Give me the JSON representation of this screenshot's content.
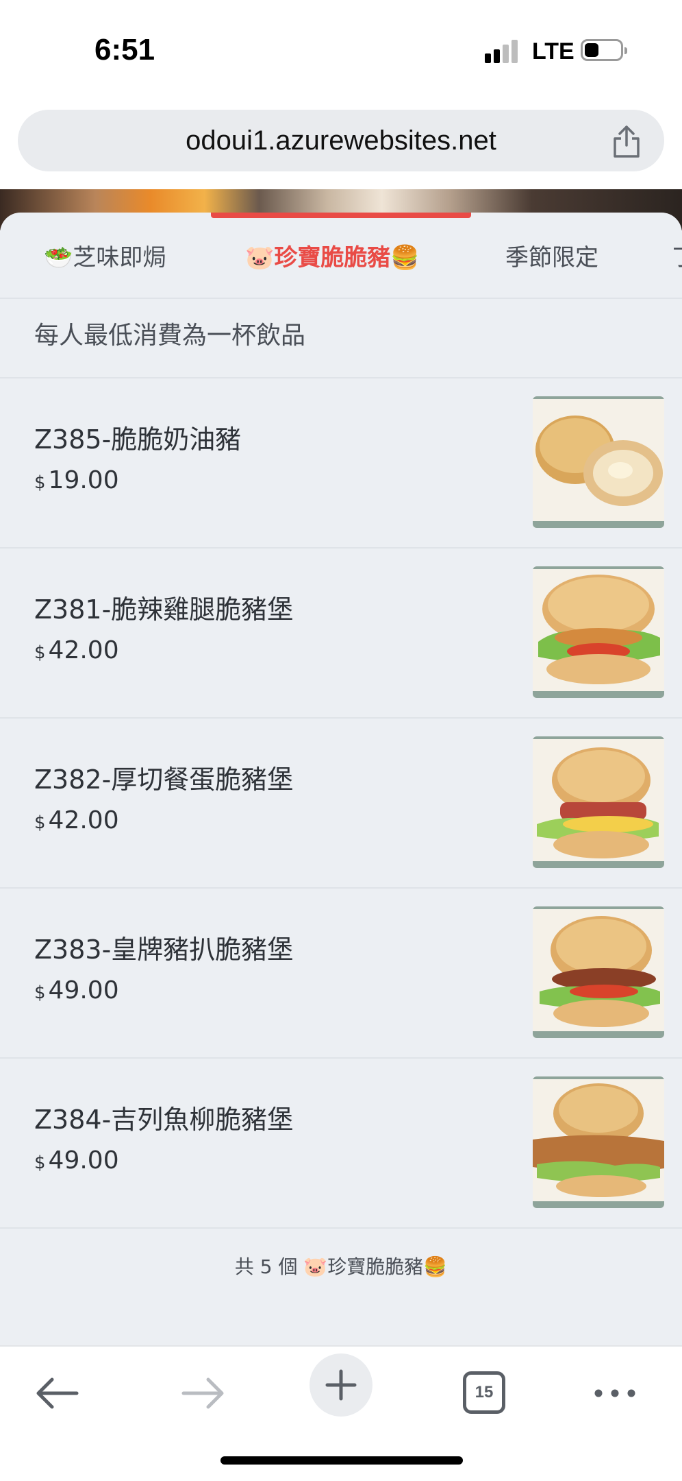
{
  "status_bar": {
    "time": "6:51",
    "network": "LTE",
    "battery_level": 0.25
  },
  "browser": {
    "url": "odoui1.azurewebsites.net",
    "share_icon": "share-icon",
    "open_tabs": "15"
  },
  "tabs": [
    {
      "emoji": "🥗",
      "label": "芝味即焗",
      "active": false
    },
    {
      "emoji": "🐷",
      "label": "珍寶脆脆豬",
      "emoji_after": "🍔",
      "active": true
    },
    {
      "emoji": "",
      "label": "季節限定",
      "active": false
    }
  ],
  "notice": "每人最低消費為一杯飲品",
  "items": [
    {
      "name": "Z385-脆脆奶油豬",
      "currency": "$",
      "price": "19.00",
      "image": "buns-with-butter"
    },
    {
      "name": "Z381-脆辣雞腿脆豬堡",
      "currency": "$",
      "price": "42.00",
      "image": "chicken-burger"
    },
    {
      "name": "Z382-厚切餐蛋脆豬堡",
      "currency": "$",
      "price": "42.00",
      "image": "spam-egg-burger"
    },
    {
      "name": "Z383-皇牌豬扒脆豬堡",
      "currency": "$",
      "price": "49.00",
      "image": "pork-chop-burger"
    },
    {
      "name": "Z384-吉列魚柳脆豬堡",
      "currency": "$",
      "price": "49.00",
      "image": "fish-fillet-burger"
    }
  ],
  "footer": {
    "prefix": "共 5 個 ",
    "emoji": "🐷",
    "label": "珍寶脆脆豬",
    "emoji_after": "🍔"
  },
  "colors": {
    "accent": "#e94b46",
    "sheet_bg": "#eceff3",
    "text": "#2e3238"
  }
}
